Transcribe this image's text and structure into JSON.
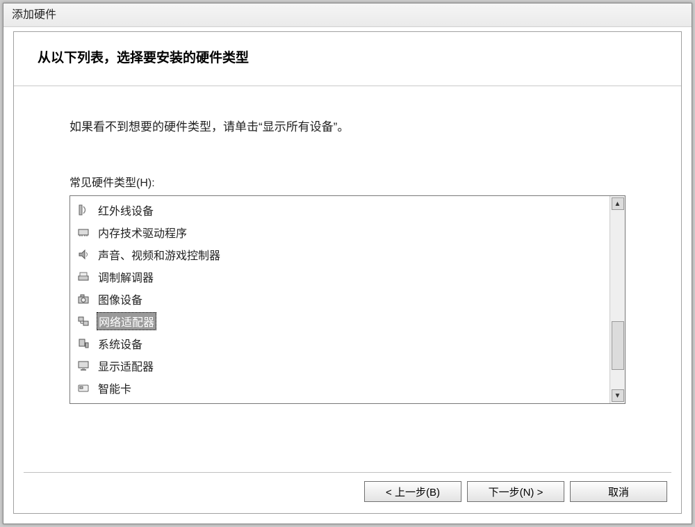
{
  "window": {
    "title": "添加硬件"
  },
  "wizard": {
    "heading": "从以下列表，选择要安装的硬件类型",
    "hint": "如果看不到想要的硬件类型，请单击“显示所有设备”。",
    "list_label": "常见硬件类型(H):"
  },
  "hardware_types": [
    {
      "icon": "infrared-icon",
      "label": "红外线设备",
      "selected": false
    },
    {
      "icon": "memory-icon",
      "label": "内存技术驱动程序",
      "selected": false
    },
    {
      "icon": "sound-icon",
      "label": "声音、视频和游戏控制器",
      "selected": false
    },
    {
      "icon": "modem-icon",
      "label": "调制解调器",
      "selected": false
    },
    {
      "icon": "imaging-icon",
      "label": "图像设备",
      "selected": false
    },
    {
      "icon": "network-icon",
      "label": "网络适配器",
      "selected": true
    },
    {
      "icon": "system-icon",
      "label": "系统设备",
      "selected": false
    },
    {
      "icon": "display-icon",
      "label": "显示适配器",
      "selected": false
    },
    {
      "icon": "smartcard-icon",
      "label": "智能卡",
      "selected": false
    }
  ],
  "buttons": {
    "back": "< 上一步(B)",
    "next": "下一步(N) >",
    "cancel": "取消"
  }
}
